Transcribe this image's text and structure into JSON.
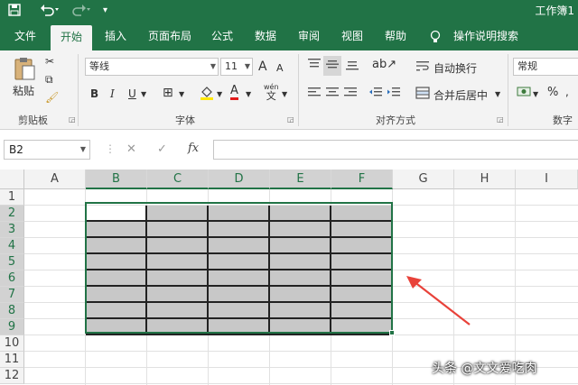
{
  "titlebar": {
    "save_icon": "save-icon",
    "undo_icon": "undo-icon",
    "redo_icon": "redo-icon",
    "customize_icon": "customize-quick-access-icon",
    "doc_title": "工作簿1"
  },
  "tabs": {
    "file": "文件",
    "home": "开始",
    "insert": "插入",
    "page_layout": "页面布局",
    "formulas": "公式",
    "data": "数据",
    "review": "审阅",
    "view": "视图",
    "help": "帮助",
    "tell_me": "操作说明搜索"
  },
  "ribbon": {
    "clipboard": {
      "paste": "粘贴",
      "label": "剪贴板"
    },
    "font": {
      "name": "等线",
      "size": "11",
      "grow": "A",
      "shrink": "A",
      "bold": "B",
      "italic": "I",
      "underline": "U",
      "font_color_letter": "A",
      "phonetic_top": "wén",
      "phonetic_bottom": "文",
      "label": "字体"
    },
    "alignment": {
      "wrap_text": "自动换行",
      "merge_center": "合并后居中",
      "label": "对齐方式"
    },
    "number": {
      "format": "常规",
      "percent": "%",
      "label": "数字"
    }
  },
  "formula_bar": {
    "name_box": "B2",
    "cancel": "✕",
    "enter": "✓",
    "fx": "fx",
    "formula": ""
  },
  "grid": {
    "columns": [
      "A",
      "B",
      "C",
      "D",
      "E",
      "F",
      "G",
      "H",
      "I"
    ],
    "rows": [
      "1",
      "2",
      "3",
      "4",
      "5",
      "6",
      "7",
      "8",
      "9",
      "10",
      "11",
      "12"
    ],
    "active_cell": "B2",
    "selection": "B2:F9",
    "selection_fill": "#c8c8c8",
    "accent": "#217346",
    "annotation": "red-arrow-pointing-to-selection"
  },
  "watermark": "头条 @文文爱吃肉"
}
